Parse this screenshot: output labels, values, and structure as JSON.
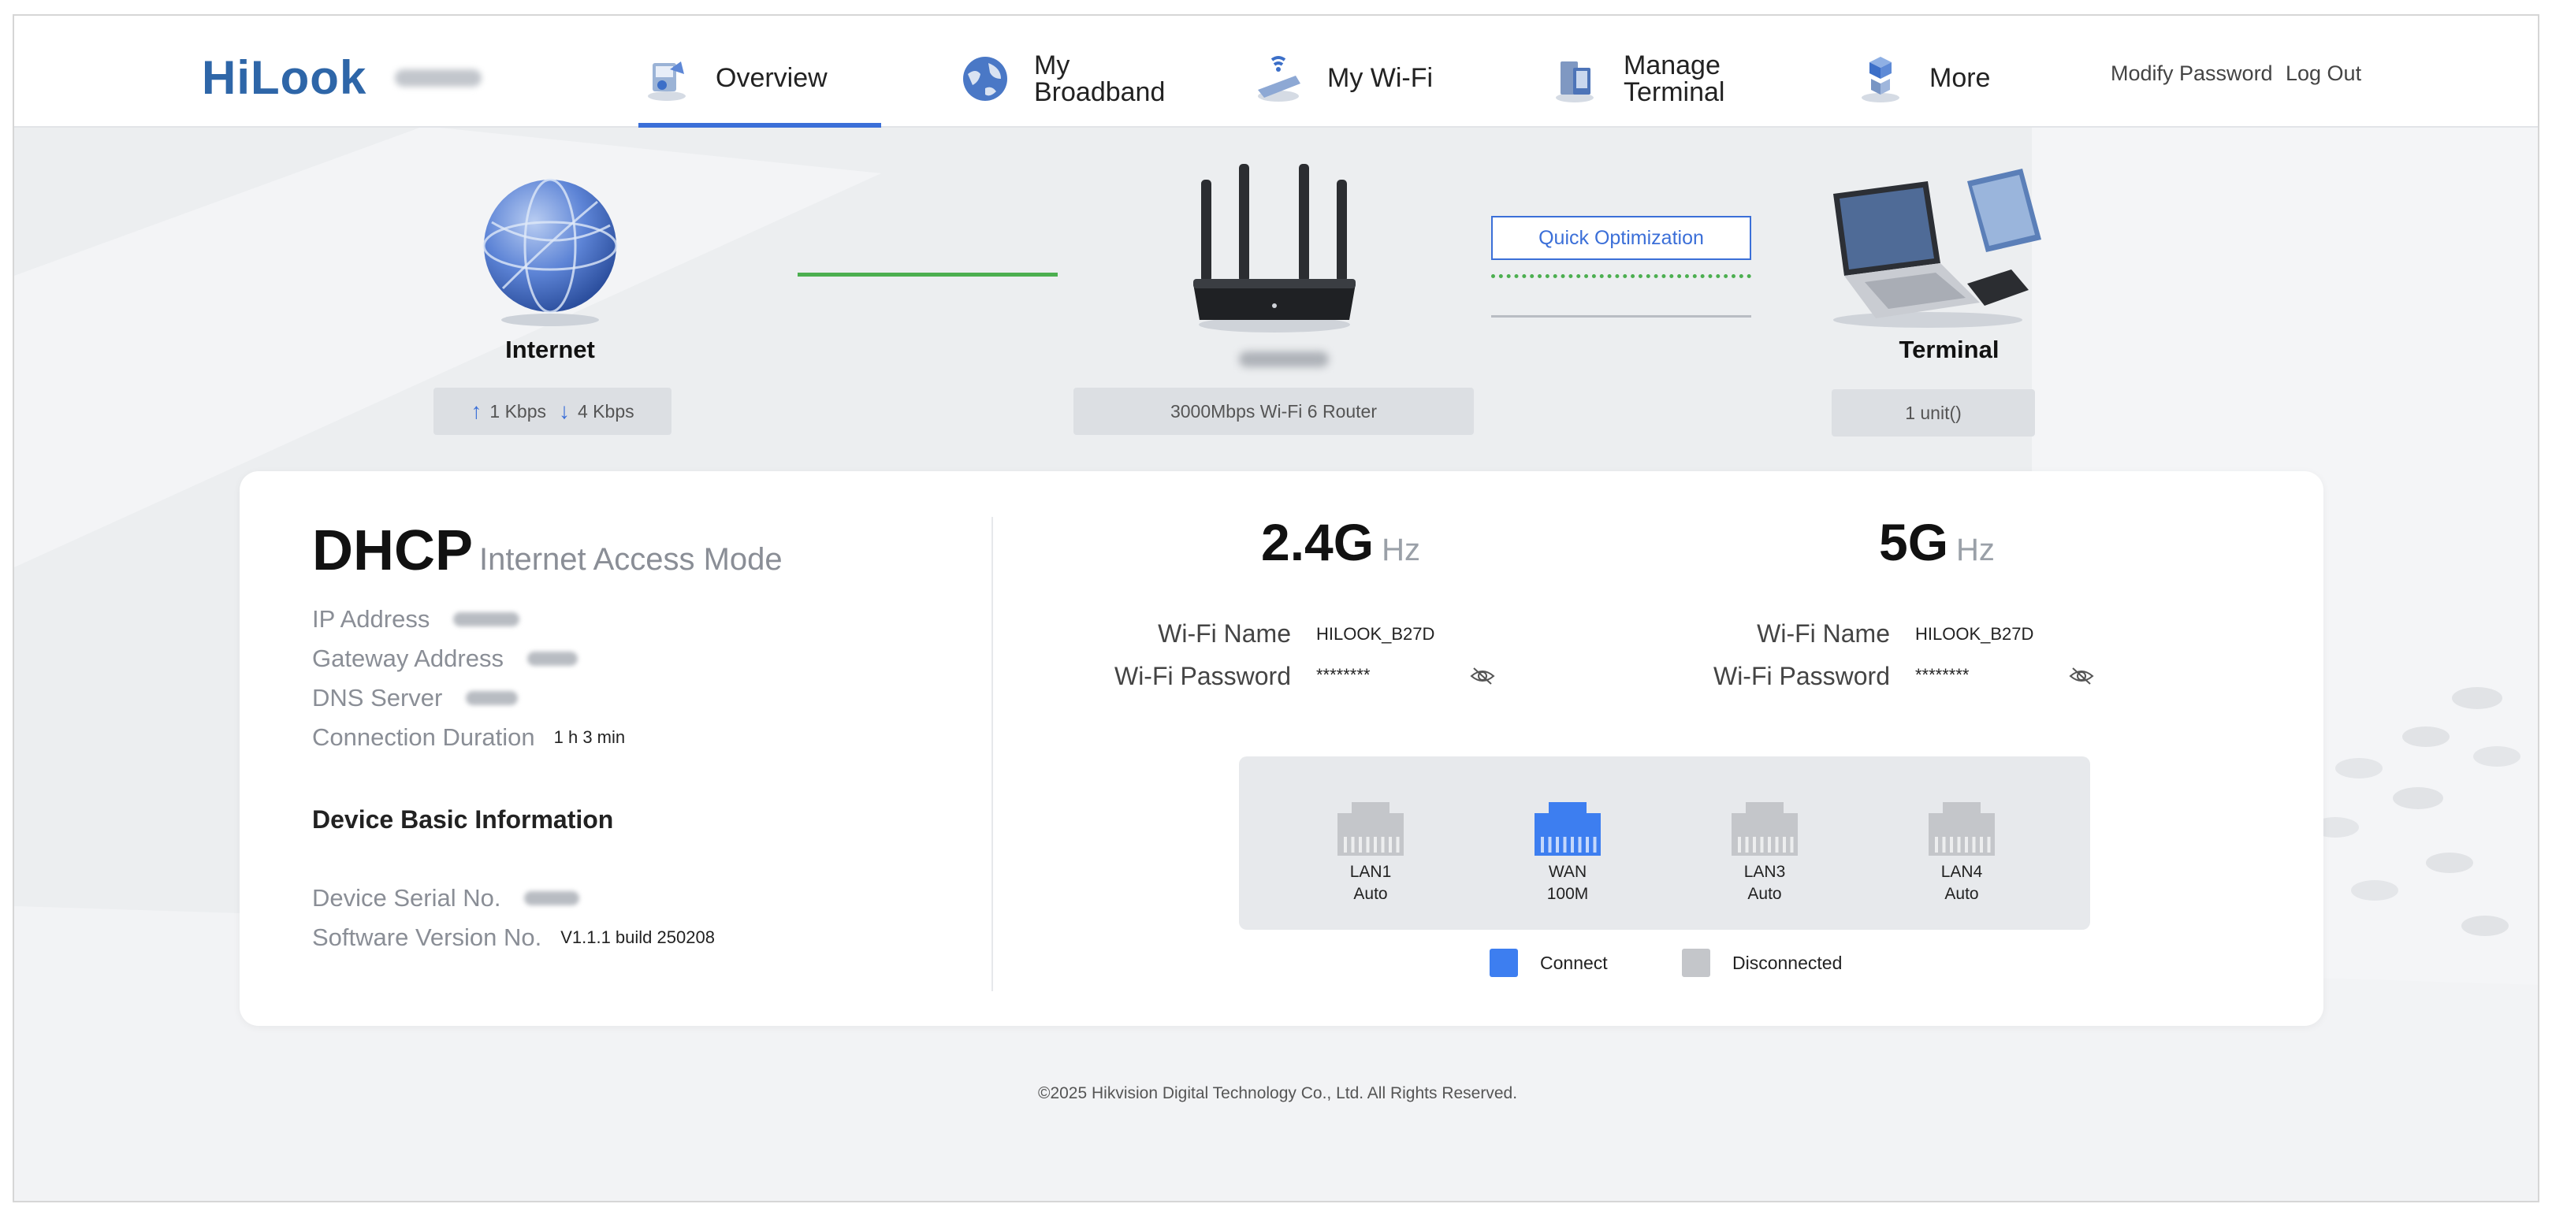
{
  "header": {
    "logo": "HiLook",
    "nav": [
      {
        "label": "Overview",
        "active": true
      },
      {
        "label": "My\nBroadband",
        "active": false
      },
      {
        "label": "My Wi-Fi",
        "active": false
      },
      {
        "label": "Manage\nTerminal",
        "active": false
      },
      {
        "label": "More",
        "active": false
      }
    ],
    "modify_password": "Modify Password",
    "log_out": "Log Out"
  },
  "topology": {
    "internet_label": "Internet",
    "upload_speed": "1 Kbps",
    "download_speed": "4 Kbps",
    "router_desc": "3000Mbps Wi-Fi 6 Router",
    "quick_optimization": "Quick Optimization",
    "terminal_label": "Terminal",
    "terminal_count": "1 unit()"
  },
  "connection": {
    "mode": "DHCP",
    "mode_caption": "Internet Access Mode",
    "ip_address_label": "IP Address",
    "gateway_label": "Gateway Address",
    "dns_label": "DNS Server",
    "duration_label": "Connection Duration",
    "duration_value": "1 h 3 min"
  },
  "device_info": {
    "title": "Device Basic Information",
    "serial_label": "Device Serial No.",
    "software_label": "Software Version No.",
    "software_value": "V1.1.1 build 250208"
  },
  "wifi": {
    "band_24": {
      "big": "2.4G",
      "unit": "Hz",
      "name_label": "Wi-Fi Name",
      "name": "HILOOK_B27D",
      "password_label": "Wi-Fi Password",
      "password": "********"
    },
    "band_5": {
      "big": "5G",
      "unit": "Hz",
      "name_label": "Wi-Fi Name",
      "name": "HILOOK_B27D",
      "password_label": "Wi-Fi Password",
      "password": "********"
    }
  },
  "ports": [
    {
      "name": "LAN1",
      "speed": "Auto",
      "connected": false
    },
    {
      "name": "WAN",
      "speed": "100M",
      "connected": true
    },
    {
      "name": "LAN3",
      "speed": "Auto",
      "connected": false
    },
    {
      "name": "LAN4",
      "speed": "Auto",
      "connected": false
    }
  ],
  "legend": {
    "connect": "Connect",
    "disconnected": "Disconnected"
  },
  "colors": {
    "accent": "#3b6fd8",
    "port_connected": "#3d7ef0",
    "port_disconnected": "#c4c6ca",
    "link_green": "#4caf50"
  },
  "footer": "©2025 Hikvision Digital Technology Co., Ltd. All Rights Reserved."
}
